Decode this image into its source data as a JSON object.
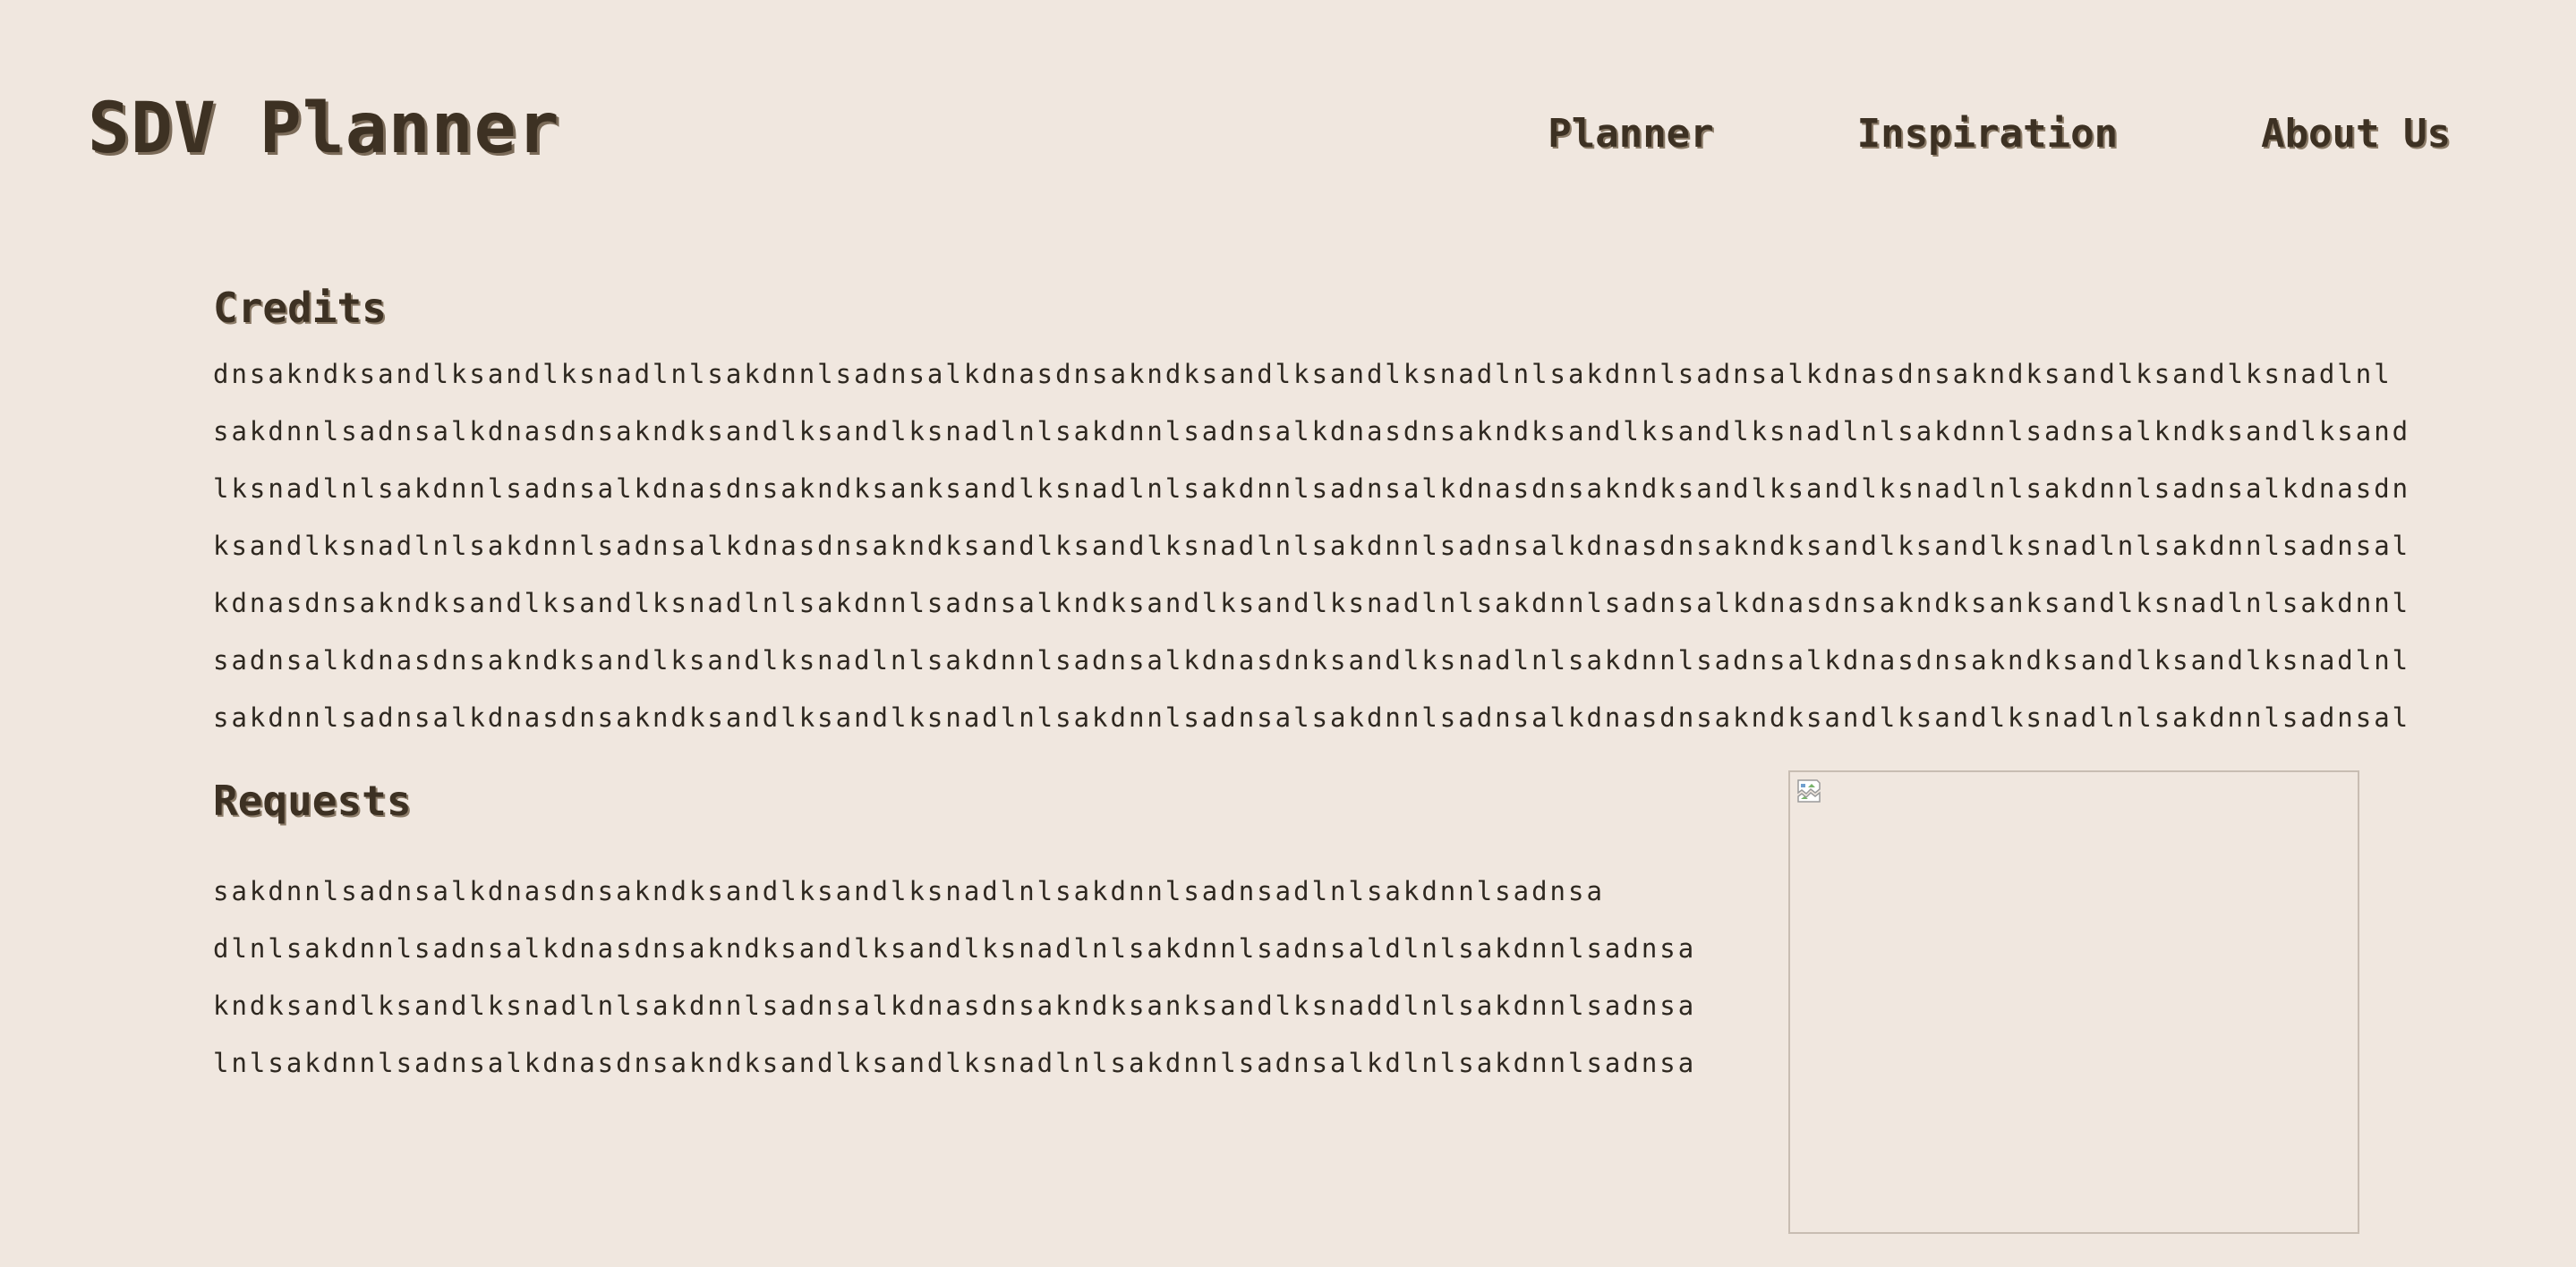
{
  "header": {
    "logo": "SDV Planner",
    "nav": [
      "Planner",
      "Inspiration",
      "About Us"
    ]
  },
  "credits": {
    "title": "Credits",
    "lines": [
      "dnsakndksandlksandlksnadlnlsakdnnlsadnsalkdnasdnsakndksandlksandlksnadlnlsakdnnlsadnsalkdnasdnsakndksandlksandlksnadlnl",
      "sakdnnlsadnsalkdnasdnsakndksandlksandlksnadlnlsakdnnlsadnsalkdnasdnsakndksandlksandlksnadlnlsakdnnlsadnsalkndksandlksand",
      "lksnadlnlsakdnnlsadnsalkdnasdnsakndksanksandlksnadlnlsakdnnlsadnsalkdnasdnsakndksandlksandlksnadlnlsakdnnlsadnsalkdnasdn",
      "ksandlksnadlnlsakdnnlsadnsalkdnasdnsakndksandlksandlksnadlnlsakdnnlsadnsalkdnasdnsakndksandlksandlksnadlnlsakdnnlsadnsal",
      "kdnasdnsakndksandlksandlksnadlnlsakdnnlsadnsalkndksandlksandlksnadlnlsakdnnlsadnsalkdnasdnsakndksanksandlksnadlnlsakdnnl",
      "sadnsalkdnasdnsakndksandlksandlksnadlnlsakdnnlsadnsalkdnasdnksandlksnadlnlsakdnnlsadnsalkdnasdnsakndksandlksandlksnadlnl",
      "sakdnnlsadnsalkdnasdnsakndksandlksandlksnadlnlsakdnnlsadnsalsakdnnlsadnsalkdnasdnsakndksandlksandlksnadlnlsakdnnlsadnsal"
    ]
  },
  "requests": {
    "title": "Requests",
    "lines": [
      "sakdnnlsadnsalkdnasdnsakndksandlksandlksnadlnlsakdnnlsadnsadlnlsakdnnlsadnsa",
      "dlnlsakdnnlsadnsalkdnasdnsakndksandlksandlksnadlnlsakdnnlsadnsaldlnlsakdnnlsadnsa",
      "kndksandlksandlksnadlnlsakdnnlsadnsalkdnasdnsakndksanksandlksnaddlnlsakdnnlsadnsa",
      "lnlsakdnnlsadnsalkdnasdnsakndksandlksandlksnadlnlsakdnnlsadnsalkdlnlsakdnnlsadnsa"
    ]
  },
  "image": {
    "icon": "broken-image-icon"
  }
}
